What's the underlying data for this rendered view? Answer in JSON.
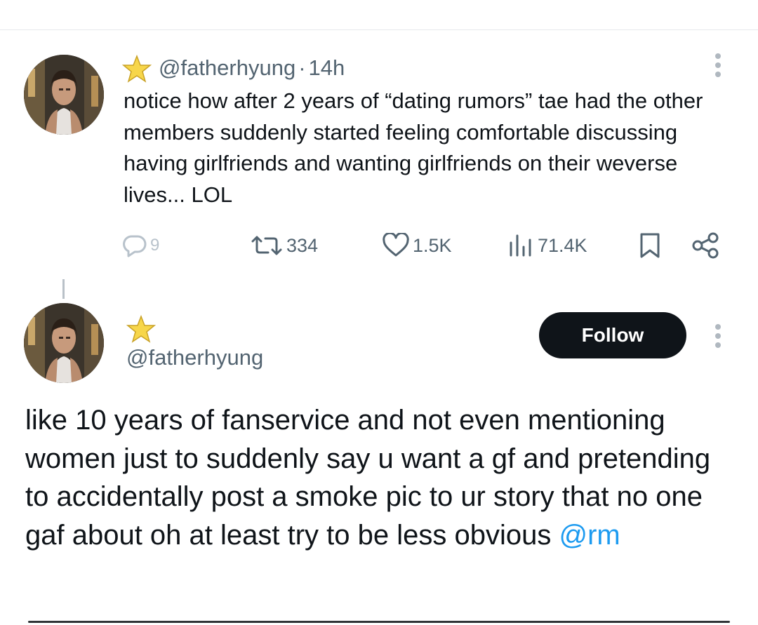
{
  "tweet": {
    "handle": "@fatherhyung",
    "separator": "·",
    "time": "14h",
    "text": "notice how after 2 years of “dating rumors” tae had the other members suddenly started feeling comfortable discussing having girlfriends and wanting girlfriends on their weverse lives... LOL",
    "stats": {
      "replies": "9",
      "reposts": "334",
      "likes": "1.5K",
      "views": "71.4K"
    }
  },
  "reply": {
    "handle": "@fatherhyung",
    "follow_label": "Follow",
    "text_main": "like 10 years of fanservice and not even mentioning women just to suddenly say u want a gf and pretending to accidentally post a smoke pic to ur story that no one gaf about oh at least try to be less obvious ",
    "mention": "@rm"
  },
  "icons": {
    "badge": "star-icon",
    "reply": "reply-icon",
    "repost": "repost-icon",
    "like": "heart-icon",
    "views": "views-icon",
    "bookmark": "bookmark-icon",
    "share": "share-icon",
    "more": "more-icon"
  },
  "colors": {
    "text": "#0f1419",
    "secondary": "#536471",
    "link": "#1d9bf0",
    "follow_bg": "#0f1419",
    "star": "#f5c518"
  }
}
